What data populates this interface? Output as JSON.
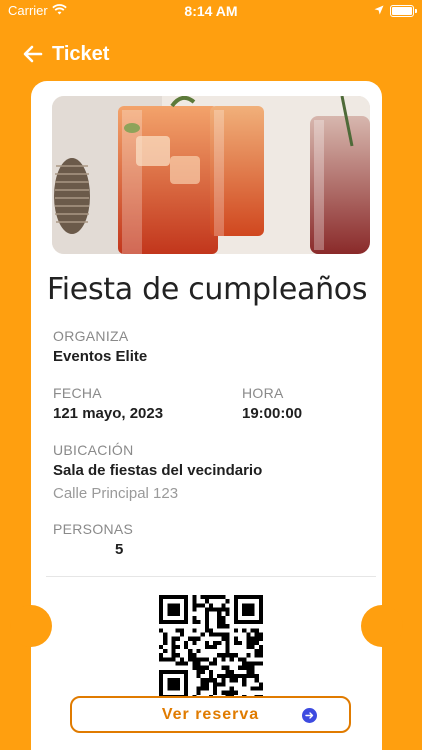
{
  "status_bar": {
    "carrier": "Carrier",
    "time": "8:14 AM"
  },
  "nav": {
    "title": "Ticket"
  },
  "event": {
    "title": "Fiesta de cumpleaños",
    "organiza_label": "ORGANIZA",
    "organiza_value": "Eventos Elite",
    "fecha_label": "FECHA",
    "fecha_value": "121 mayo, 2023",
    "hora_label": "HORA",
    "hora_value": "19:00:00",
    "ubicacion_label": "UBICACIÓN",
    "ubicacion_name": "Sala de fiestas del vecindario",
    "ubicacion_address": "Calle Principal 123",
    "personas_label": "PERSONAS",
    "personas_value": "5"
  },
  "cta": {
    "label": "Ver reserva"
  },
  "colors": {
    "background": "#FF9F0F",
    "accent": "#E07B00",
    "icon_blue": "#3D4BE0"
  },
  "icons": [
    "wifi-icon",
    "location-arrow-icon",
    "battery-icon",
    "back-arrow-icon",
    "arrow-right-circle-icon"
  ]
}
